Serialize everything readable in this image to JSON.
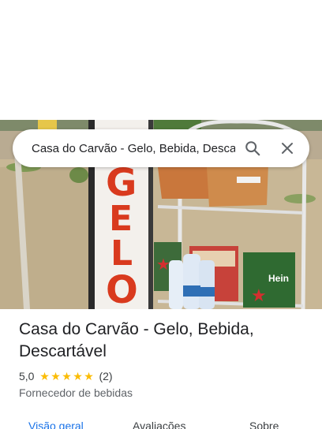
{
  "search": {
    "query": "Casa do Carvão - Gelo, Bebida, Descartável",
    "search_icon": "search-icon",
    "clear_icon": "close-icon"
  },
  "place": {
    "title": "Casa do Carvão - Gelo, Bebida, Descartável",
    "rating": "5,0",
    "stars": 5,
    "review_count": "(2)",
    "category": "Fornecedor de bebidas",
    "sign_text": "GELO"
  },
  "tabs": [
    {
      "label": "Visão geral",
      "active": true
    },
    {
      "label": "Avaliações",
      "active": false
    },
    {
      "label": "Sobre",
      "active": false
    }
  ],
  "colors": {
    "accent": "#1a73e8",
    "star": "#fbbc04",
    "sign_red": "#d93a1e"
  }
}
